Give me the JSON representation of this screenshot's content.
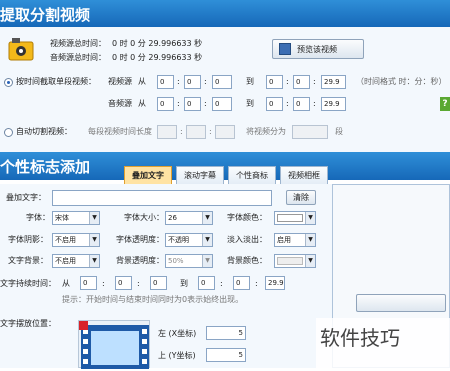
{
  "section1": {
    "title": "提取分割视频"
  },
  "info": {
    "video_label": "视频源总时间：",
    "audio_label": "音频源总时间：",
    "video_time": "0 时 0 分 29.996633 秒",
    "audio_time": "0 时 0 分 29.996633 秒"
  },
  "preview_button": "预览该视频",
  "cut_mode": {
    "label": "按时间截取单段视频：",
    "video_src": "视频源",
    "audio_src": "音频源",
    "from": "从",
    "to": "到",
    "video_start": [
      "0",
      "0",
      "0"
    ],
    "video_end": [
      "0",
      "0",
      "29.9"
    ],
    "audio_start": [
      "0",
      "0",
      "0"
    ],
    "audio_end": [
      "0",
      "0",
      "29.9"
    ],
    "hint": "（时间格式 时：分：秒）"
  },
  "auto_mode": {
    "label": "自动切割视频：",
    "segment_label": "每段视频时间长度",
    "split_label": "将视频分为",
    "split_unit": "段"
  },
  "section2": {
    "title": "个性标志添加"
  },
  "tabs": [
    "叠加文字",
    "滚动字幕",
    "个性商标",
    "视频相框"
  ],
  "overlay": {
    "text_label": "叠加文字：",
    "text_value": "",
    "clear_button": "清除",
    "font_label": "字体：",
    "font_value": "宋体",
    "size_label": "字体大小：",
    "size_value": "26",
    "color_label": "字体颜色：",
    "shadow_label": "字体阴影：",
    "shadow_value": "不启用",
    "opacity_label": "字体透明度：",
    "opacity_value": "不透明",
    "fade_label": "淡入淡出：",
    "fade_value": "启用",
    "bg_label": "文字背景：",
    "bg_value": "不启用",
    "bg_opacity_label": "背景透明度：",
    "bg_opacity_value": "50%",
    "bg_color_label": "背景颜色：",
    "duration_label": "文字持续时间：",
    "dur_from": "从",
    "dur_to": "到",
    "dur_start": [
      "0",
      "0",
      "0"
    ],
    "dur_end": [
      "0",
      "0",
      "29.9"
    ],
    "dur_hint": "提示：开始时间与结束时间同时为0表示始终出现。",
    "position_label": "文字摆放位置：",
    "left_label": "左 (X坐标)",
    "left_value": "5",
    "top_label": "上 (Y坐标)",
    "top_value": "5"
  },
  "watermark": "软件技巧",
  "colors": {
    "header": "#1f78c8",
    "accent_tab": "#ffe3a3",
    "border": "#8aa5c5"
  }
}
